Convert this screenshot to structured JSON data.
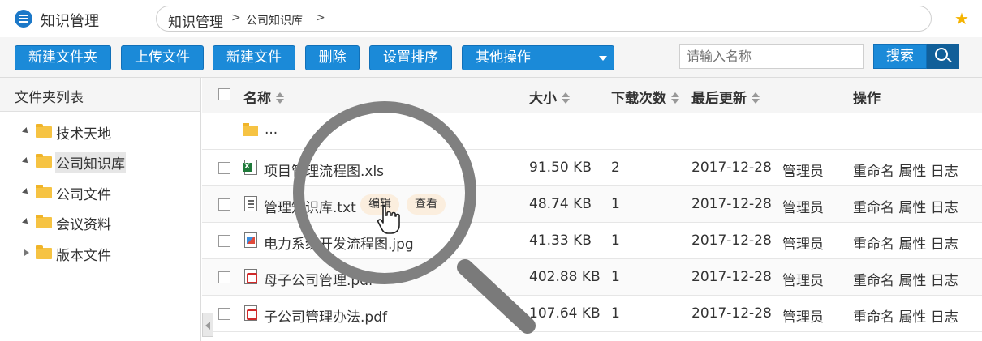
{
  "header": {
    "app_title": "知识管理",
    "breadcrumb": [
      "知识管理",
      "公司知识库"
    ],
    "breadcrumb_separator": ">",
    "star_icon": "star-icon",
    "accent_color": "#1b8ad8"
  },
  "toolbar": {
    "buttons": [
      "新建文件夹",
      "上传文件",
      "新建文件",
      "删除",
      "设置排序"
    ],
    "dropdown_label": "其他操作",
    "search_placeholder": "请输入名称",
    "search_button": "搜索"
  },
  "sidebar": {
    "title": "文件夹列表",
    "items": [
      {
        "label": "技术天地",
        "expanded": true,
        "selected": false
      },
      {
        "label": "公司知识库",
        "expanded": true,
        "selected": true
      },
      {
        "label": "公司文件",
        "expanded": true,
        "selected": false
      },
      {
        "label": "会议资料",
        "expanded": true,
        "selected": false
      },
      {
        "label": "版本文件",
        "expanded": false,
        "selected": false
      }
    ]
  },
  "table": {
    "columns": [
      "名称",
      "大小",
      "下载次数",
      "最后更新",
      "操作"
    ],
    "parent_folder": "...",
    "rows": [
      {
        "name": "项目管理流程图.xls",
        "icon": "xls-file-icon",
        "size": "91.50 KB",
        "downloads": "2",
        "date": "2017-12-28",
        "user": "管理员",
        "actions": "重命名 属性 日志"
      },
      {
        "name": "管理知识库.txt",
        "icon": "txt-file-icon",
        "size": "48.74 KB",
        "downloads": "1",
        "date": "2017-12-28",
        "user": "管理员",
        "actions": "重命名 属性 日志",
        "inline_actions": [
          "编辑",
          "查看"
        ]
      },
      {
        "name": "电力系统开发流程图.jpg",
        "icon": "image-file-icon",
        "size": "41.33 KB",
        "downloads": "1",
        "date": "2017-12-28",
        "user": "管理员",
        "actions": "重命名 属性 日志"
      },
      {
        "name": "母子公司管理.pdf",
        "icon": "pdf-file-icon",
        "size": "402.88 KB",
        "downloads": "1",
        "date": "2017-12-28",
        "user": "管理员",
        "actions": "重命名 属性 日志"
      },
      {
        "name": "子公司管理办法.pdf",
        "icon": "pdf-file-icon",
        "size": "107.64 KB",
        "downloads": "1",
        "date": "2017-12-28",
        "user": "管理员",
        "actions": "重命名 属性 日志"
      }
    ]
  },
  "overlay": {
    "magnifier": "magnifier-icon",
    "cursor": "hand-cursor-icon"
  }
}
